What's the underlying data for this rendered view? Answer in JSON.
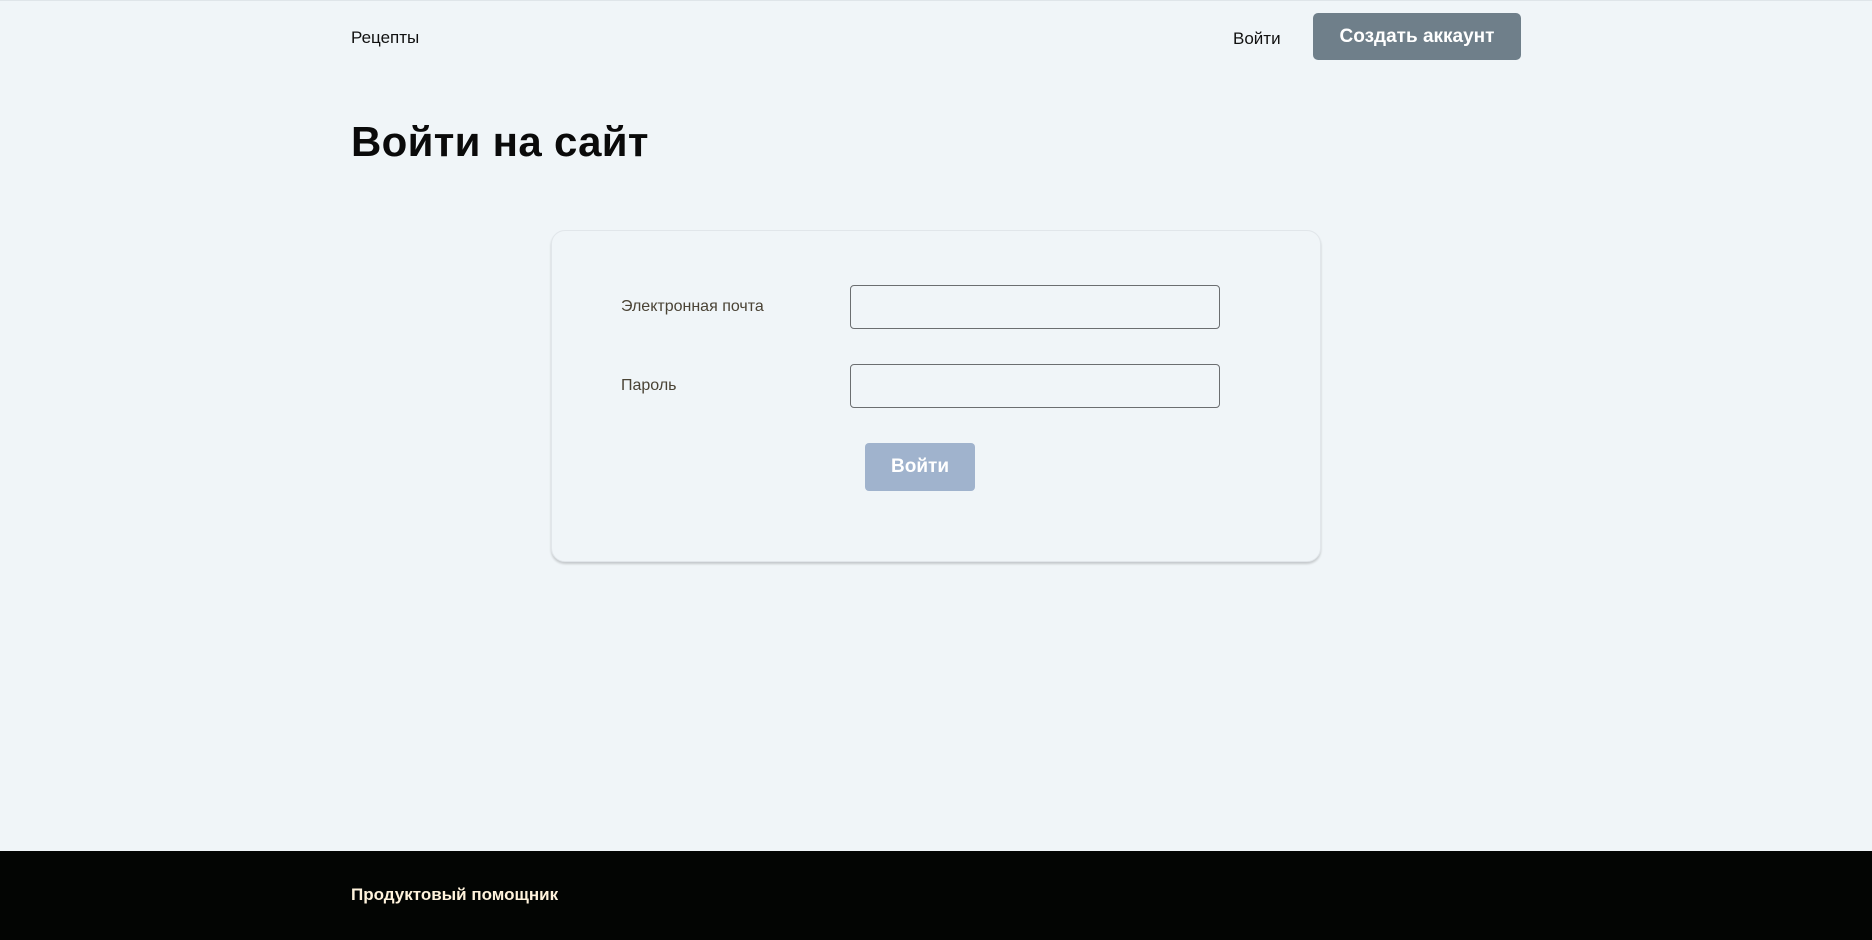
{
  "header": {
    "recipes_link": "Рецепты",
    "login_link": "Войти",
    "create_account_button": "Создать аккаунт"
  },
  "main": {
    "title": "Войти на сайт",
    "form": {
      "email_label": "Электронная почта",
      "email_value": "",
      "password_label": "Пароль",
      "password_value": "",
      "submit_label": "Войти"
    }
  },
  "footer": {
    "brand": "Продуктовый помощник"
  },
  "colors": {
    "background": "#f0f5f8",
    "create_account_button_bg": "#6f7f8a",
    "submit_button_bg": "#a0b3cd",
    "footer_bg": "#030503",
    "footer_text": "#fff3dc"
  }
}
